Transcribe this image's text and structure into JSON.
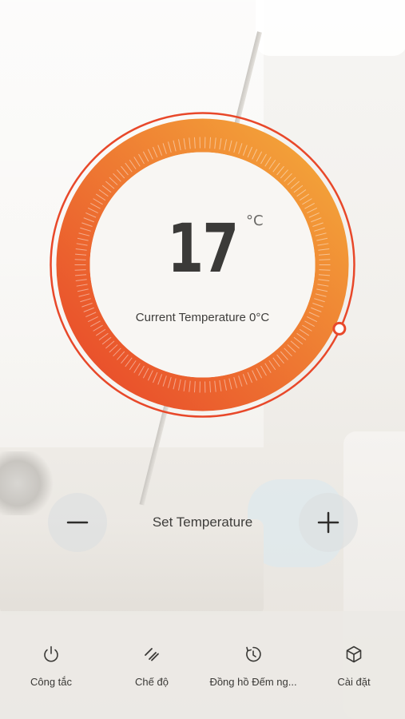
{
  "thermostat": {
    "set_value": "17",
    "unit": "°C",
    "current_label": "Current Temperature 0°C",
    "level_fraction": 0.35
  },
  "controls": {
    "set_label": "Set Temperature"
  },
  "tabs": [
    {
      "label": "Công tắc",
      "icon": "power-icon"
    },
    {
      "label": "Chế độ",
      "icon": "mode-icon"
    },
    {
      "label": "Đồng hồ Đếm ng...",
      "icon": "timer-icon"
    },
    {
      "label": "Cài đặt",
      "icon": "settings-cube-icon"
    }
  ],
  "colors": {
    "ring_start": "#e8482a",
    "ring_end": "#f4a93a",
    "text_dark": "#3b3a38"
  }
}
